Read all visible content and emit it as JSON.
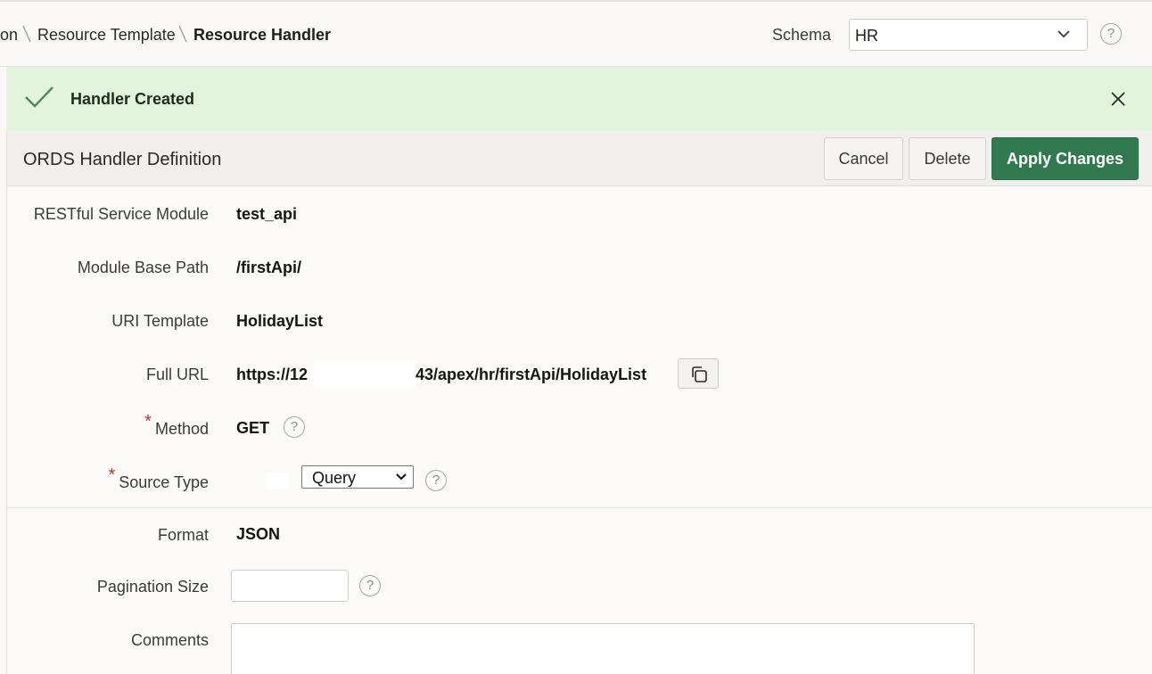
{
  "breadcrumb": {
    "items": [
      "on",
      "Resource Template",
      "Resource Handler"
    ]
  },
  "schema": {
    "label": "Schema",
    "value": "HR"
  },
  "alert": {
    "message": "Handler Created"
  },
  "region": {
    "title": "ORDS Handler Definition",
    "buttons": {
      "cancel": "Cancel",
      "delete": "Delete",
      "apply": "Apply Changes"
    }
  },
  "fields": {
    "module": {
      "label": "RESTful Service Module",
      "value": "test_api"
    },
    "base_path": {
      "label": "Module Base Path",
      "value": "/firstApi/"
    },
    "uri_template": {
      "label": "URI Template",
      "value": "HolidayList"
    },
    "full_url": {
      "label": "Full URL",
      "value_start": "https://12",
      "value_end": "43/apex/hr/firstApi/HolidayList"
    },
    "method": {
      "label": "Method",
      "required_mark": "*",
      "value": "GET"
    },
    "source_type": {
      "label": "Source Type",
      "required_mark": "*",
      "value": "Query"
    },
    "format": {
      "label": "Format",
      "value": "JSON"
    },
    "pagination": {
      "label": "Pagination Size",
      "value": ""
    },
    "comments": {
      "label": "Comments",
      "value": ""
    }
  },
  "icons": {
    "help": "?",
    "alert_icon": "check-icon",
    "close": "close-icon",
    "copy": "copy-icon"
  },
  "colors": {
    "success_bg": "#e2f4dc",
    "hot_button": "#317a4f",
    "required": "#b3392b"
  }
}
